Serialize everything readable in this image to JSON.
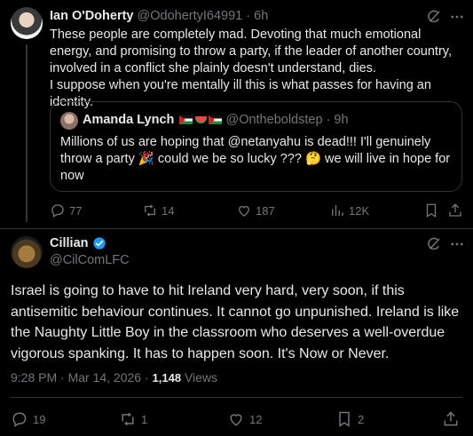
{
  "tweet1": {
    "author_name": "Ian O'Doherty",
    "author_handle": "@OdohertyI64991",
    "time": "6h",
    "text": "These people are completely mad. Devoting that much emotional energy, and promising to throw a party, if the leader of another country, involved in a conflict she plainly doesn't understand, dies.\nI suppose when you're mentally ill this is what passes for having an identity.",
    "quote": {
      "author_name": "Amanda Lynch",
      "author_handle": "@Ontheboldstep",
      "time": "9h",
      "text": "Millions of us are hoping that @netanyahu  is dead!!!  I'll genuinely throw a  party 🎉  could we be so lucky ??? 🤔 we will live in hope for now"
    },
    "stats": {
      "replies": "77",
      "reposts": "14",
      "likes": "187",
      "views": "12K"
    }
  },
  "tweet2": {
    "author_name": "Cillian",
    "author_handle": "@CilComLFC",
    "text": "Israel is going to have to hit Ireland very hard, very soon, if this antisemitic behaviour continues. It cannot go unpunished. Ireland is like the Naughty Little Boy in the classroom who deserves a well-overdue vigorous spanking. It has to happen soon. It's Now or Never.",
    "timestamp": "9:28 PM · Mar 14, 2026 · ",
    "views_count": "1,148",
    "views_label": "Views",
    "stats": {
      "replies": "19",
      "reposts": "1",
      "likes": "12",
      "bookmarks": "2"
    }
  },
  "colors": {
    "background": "#000000",
    "text": "#e7e9ea",
    "muted": "#71767b",
    "border": "#2f3336",
    "verified": "#1d9bf0"
  }
}
